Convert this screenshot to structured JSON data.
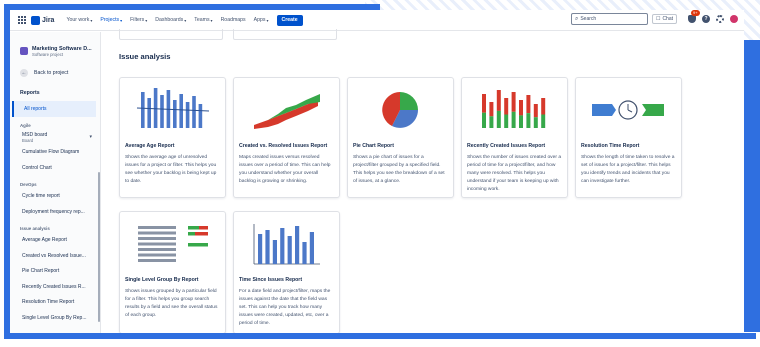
{
  "nav": {
    "logo": "Jira",
    "items": [
      {
        "label": "Your work",
        "chevron": true,
        "active": false
      },
      {
        "label": "Projects",
        "chevron": true,
        "active": true
      },
      {
        "label": "Filters",
        "chevron": true,
        "active": false
      },
      {
        "label": "Dashboards",
        "chevron": true,
        "active": false
      },
      {
        "label": "Teams",
        "chevron": true,
        "active": false
      },
      {
        "label": "Roadmaps",
        "chevron": false,
        "active": false
      },
      {
        "label": "Apps",
        "chevron": true,
        "active": false
      }
    ],
    "create_label": "Create",
    "search_placeholder": "Search",
    "chat_label": "Chat",
    "notification_count": "9+"
  },
  "sidebar": {
    "project_name": "Marketing Software D...",
    "project_type": "Software project",
    "back_label": "Back to project",
    "reports_heading": "Reports",
    "all_reports": "All reports",
    "sections": [
      {
        "title": "Agile",
        "board_name": "MSD board",
        "board_sub": "Board",
        "items": [
          "Cumulative Flow Diagram",
          "Control Chart"
        ]
      },
      {
        "title": "DevOps",
        "items": [
          "Cycle time report",
          "Deployment frequency rep..."
        ]
      },
      {
        "title": "Issue analysis",
        "items": [
          "Average Age Report",
          "Created vs Resolved Issue...",
          "Pie Chart Report",
          "Recently Created Issues R...",
          "Resolution Time Report",
          "Single Level Group By Rep..."
        ]
      }
    ]
  },
  "main": {
    "section_title": "Issue analysis",
    "cards": [
      {
        "title": "Average Age Report",
        "desc": "Shows the average age of unresolved issues for a project or filter. This helps you see whether your backlog is being kept up to date.",
        "img": "avg-age"
      },
      {
        "title": "Created vs. Resolved Issues Report",
        "desc": "Maps created issues versus resolved issues over a period of time. This can help you understand whether your overall backlog is growing or shrinking.",
        "img": "created-resolved"
      },
      {
        "title": "Pie Chart Report",
        "desc": "Shows a pie chart of issues for a project/filter grouped by a specified field. This helps you see the breakdown of a set of issues, at a glance.",
        "img": "pie"
      },
      {
        "title": "Recently Created Issues Report",
        "desc": "Shows the number of issues created over a period of time for a project/filter, and how many were resolved. This helps you understand if your team is keeping up with incoming work.",
        "img": "recent"
      },
      {
        "title": "Resolution Time Report",
        "desc": "Shows the length of time taken to resolve a set of issues for a project/filter. This helps you identify trends and incidents that you can investigate further.",
        "img": "resolution"
      },
      {
        "title": "Single Level Group By Report",
        "desc": "Shows issues grouped by a particular field for a filter. This helps you group search results by a field and see the overall status of each group.",
        "img": "group"
      },
      {
        "title": "Time Since Issues Report",
        "desc": "For a date field and project/filter, maps the issues against the date that the field was set. This can help you track how many issues were created, updated, etc, over a period of time.",
        "img": "time-since"
      }
    ]
  },
  "colors": {
    "accent": "#0052cc",
    "frame": "#2f6fe0",
    "bar_blue": "#4c78c8",
    "green": "#37a84a",
    "red": "#d6392b"
  }
}
